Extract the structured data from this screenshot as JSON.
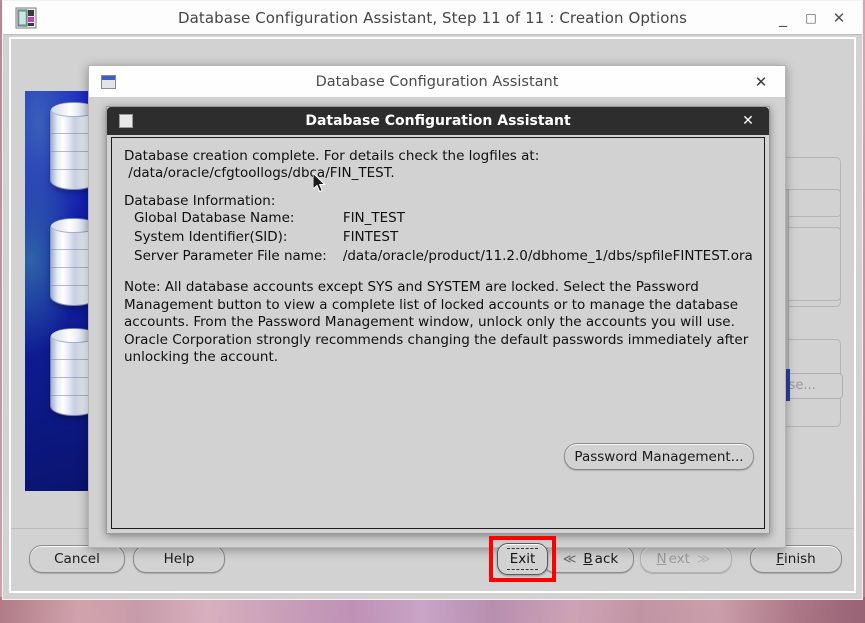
{
  "window": {
    "title": "Database Configuration Assistant, Step 11 of 11 : Creation Options",
    "icon": "database-app-icon",
    "controls": {
      "minimize": "_",
      "maximize": "□",
      "close": "✕"
    }
  },
  "background_form": {
    "browse_button_label": "wse...",
    "scrollbar": "vertical-scrollbar"
  },
  "footer": {
    "cancel_label": "Cancel",
    "help_label": "Help",
    "back": {
      "mnemonic": "B",
      "rest": "ack",
      "chevron": "≪",
      "enabled": true
    },
    "next": {
      "mnemonic": "N",
      "rest": "ext",
      "chevron": "≫",
      "enabled": false
    },
    "finish": {
      "mnemonic": "F",
      "rest": "inish",
      "enabled": true
    }
  },
  "dialog_outer": {
    "title": "Database Configuration Assistant",
    "close": "✕"
  },
  "dialog_inner": {
    "title": "Database Configuration Assistant",
    "close": "✕",
    "message_line_1": "Database creation complete. For details check the logfiles at:",
    "message_line_2": " /data/oracle/cfgtoollogs/dbca/FIN_TEST.",
    "info_heading": "Database Information:",
    "info_rows": [
      {
        "label": "Global Database Name:",
        "value": "FIN_TEST"
      },
      {
        "label": "System Identifier(SID):",
        "value": "FINTEST"
      },
      {
        "label": "Server Parameter File name:",
        "value": "/data/oracle/product/11.2.0/dbhome_1/dbs/spfileFINTEST.ora"
      }
    ],
    "note": "Note: All database accounts except SYS and SYSTEM are locked. Select the Password Management button to view a complete list of locked accounts or to manage the database accounts. From the Password Management window, unlock only the accounts you will use. Oracle Corporation strongly recommends changing the default passwords immediately after unlocking the account.",
    "password_management_label": "Password Management...",
    "exit_label": "Exit",
    "highlight_color": "#ff0000"
  }
}
